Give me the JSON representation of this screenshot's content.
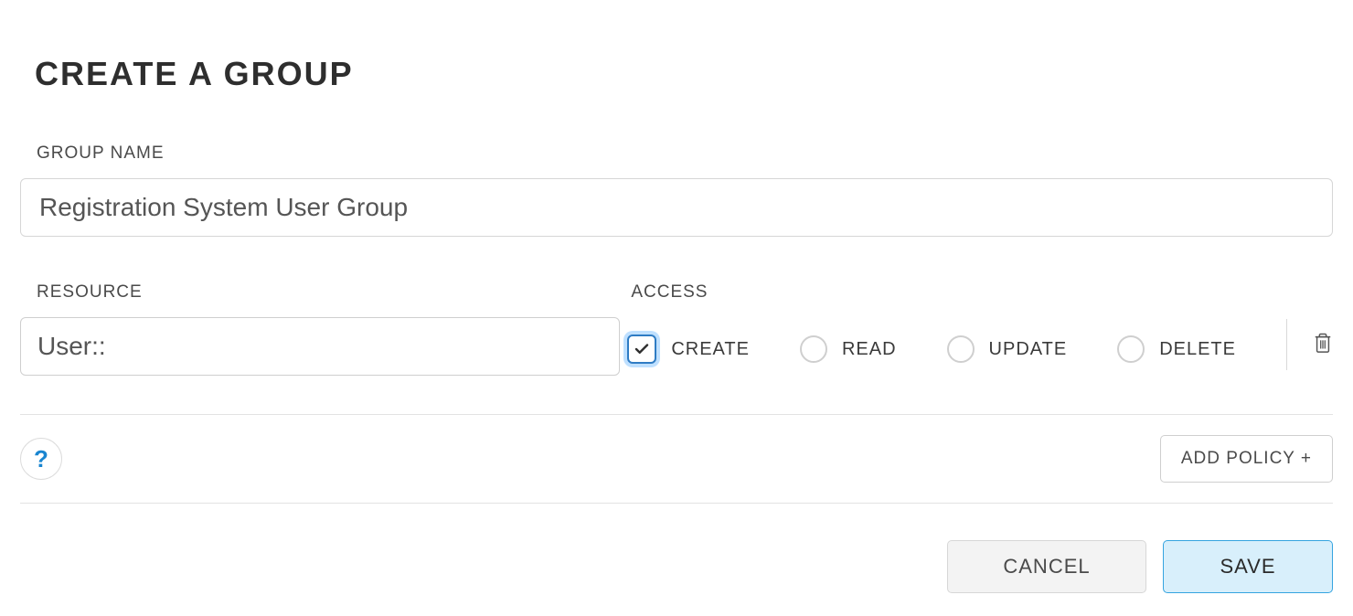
{
  "title": "CREATE A GROUP",
  "groupName": {
    "label": "GROUP NAME",
    "value": "Registration System User Group"
  },
  "resource": {
    "label": "RESOURCE",
    "value": "User::"
  },
  "access": {
    "label": "ACCESS",
    "items": [
      {
        "label": "CREATE",
        "checked": true,
        "kind": "checkbox"
      },
      {
        "label": "READ",
        "checked": false,
        "kind": "radio"
      },
      {
        "label": "UPDATE",
        "checked": false,
        "kind": "radio"
      },
      {
        "label": "DELETE",
        "checked": false,
        "kind": "radio"
      }
    ]
  },
  "help": {
    "label": "?"
  },
  "addPolicy": {
    "label": "ADD POLICY +"
  },
  "actions": {
    "cancel": "CANCEL",
    "save": "SAVE"
  }
}
